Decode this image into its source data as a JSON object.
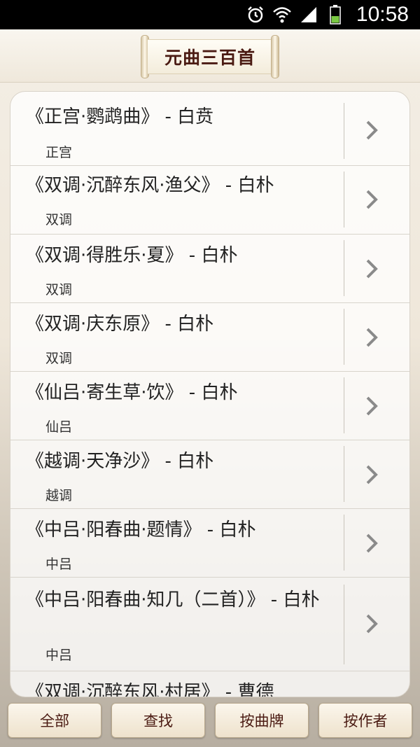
{
  "status_bar": {
    "time": "10:58",
    "icons": [
      "alarm-icon",
      "wifi-icon",
      "signal-icon",
      "battery-icon"
    ]
  },
  "header": {
    "title": "元曲三百首"
  },
  "list": {
    "items": [
      {
        "title": "《正宫·鹦鹉曲》 - 白贲",
        "subtitle": "正宫"
      },
      {
        "title": "《双调·沉醉东风·渔父》 - 白朴",
        "subtitle": "双调"
      },
      {
        "title": "《双调·得胜乐·夏》 - 白朴",
        "subtitle": "双调"
      },
      {
        "title": "《双调·庆东原》 - 白朴",
        "subtitle": "双调"
      },
      {
        "title": "《仙吕·寄生草·饮》 - 白朴",
        "subtitle": "仙吕"
      },
      {
        "title": "《越调·天净沙》 - 白朴",
        "subtitle": "越调"
      },
      {
        "title": "《中吕·阳春曲·题情》 - 白朴",
        "subtitle": "中吕"
      },
      {
        "title": "《中吕·阳春曲·知几（二首）》 - 白朴",
        "subtitle": "中吕"
      },
      {
        "title": "《双调·沉醉东风·村居》 - 曹德",
        "subtitle": ""
      }
    ]
  },
  "bottom_buttons": {
    "all": "全部",
    "search": "查找",
    "by_tune": "按曲牌",
    "by_author": "按作者"
  },
  "colors": {
    "title_color": "#4a1a12",
    "status_bar_bg": "#000000"
  }
}
